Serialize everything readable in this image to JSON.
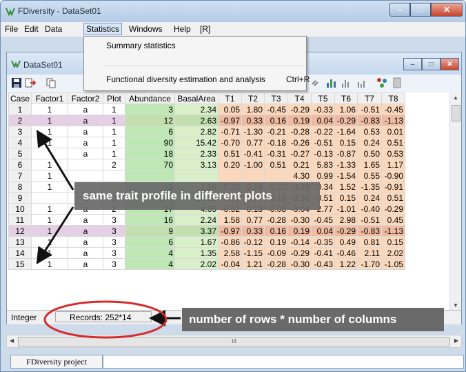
{
  "app": {
    "title": "FDiversity - DataSet01",
    "window_buttons": {
      "minimize": "–",
      "maximize": "□",
      "close": "✕"
    }
  },
  "menubar": [
    "File",
    "Edit",
    "Data",
    "Statistics",
    "Windows",
    "Help",
    "[R]"
  ],
  "statistics_menu": {
    "items": [
      {
        "label": "Summary statistics",
        "shortcut": ""
      },
      {
        "label": "Functional diversity estimation and analysis",
        "shortcut": "Ctrl+R"
      }
    ]
  },
  "dataset_window": {
    "title": "DataSet01"
  },
  "grid": {
    "columns": [
      "Case",
      "Factor1",
      "Factor2",
      "Plot",
      "Abundance",
      "BasalArea",
      "T1",
      "T2",
      "T3",
      "T4",
      "T5",
      "T6",
      "T7",
      "T8"
    ],
    "rows": [
      [
        "1",
        "1",
        "a",
        "1",
        "3",
        "2.34",
        "0.05",
        "1.80",
        "-0.45",
        "-0.29",
        "-0.33",
        "1.06",
        "-0.51",
        "-0.45"
      ],
      [
        "2",
        "1",
        "a",
        "1",
        "12",
        "2.63",
        "-0.97",
        "0.33",
        "0.16",
        "0.19",
        "0.04",
        "-0.29",
        "-0.83",
        "-1.13"
      ],
      [
        "3",
        "1",
        "a",
        "1",
        "6",
        "2.82",
        "-0.71",
        "-1.30",
        "-0.21",
        "-0.28",
        "-0.22",
        "-1.64",
        "0.53",
        "0.01"
      ],
      [
        "4",
        "1",
        "a",
        "1",
        "90",
        "15.42",
        "-0.70",
        "0.77",
        "-0.18",
        "-0.26",
        "-0.51",
        "0.15",
        "0.24",
        "0.51"
      ],
      [
        "5",
        "",
        "a",
        "1",
        "18",
        "2.33",
        "0.51",
        "-0.41",
        "-0.31",
        "-0.27",
        "-0.13",
        "-0.87",
        "0.50",
        "0.53"
      ],
      [
        "6",
        "1",
        "",
        "2",
        "70",
        "3.13",
        "0.20",
        "-1.00",
        "0.51",
        "0.21",
        "5.83",
        "-1.33",
        "1.65",
        "1.17"
      ],
      [
        "7",
        "1",
        "",
        "",
        "",
        "",
        "",
        "",
        "",
        "4.30",
        "0.99",
        "-1.54",
        "0.55",
        "-0.90"
      ],
      [
        "8",
        "1",
        "",
        "",
        "1",
        "1.28",
        "-0.20",
        "0.18",
        "-0.27",
        "-0.29",
        "-0.34",
        "1.52",
        "-1.35",
        "-0.91"
      ],
      [
        "9",
        "",
        "a",
        "2",
        "140",
        "21.02",
        "-0.70",
        "0.77",
        "-0.18",
        "-0.26",
        "-0.51",
        "0.15",
        "0.24",
        "0.51"
      ],
      [
        "10",
        "1",
        "a",
        "2",
        "17",
        "4.65",
        "-0.52",
        "0.18",
        "-0.08",
        "-0.04",
        "2.77",
        "-1.01",
        "-0.40",
        "-0.29"
      ],
      [
        "11",
        "1",
        "a",
        "3",
        "16",
        "2.24",
        "1.58",
        "0.77",
        "-0.28",
        "-0.30",
        "-0.45",
        "2.98",
        "-0.51",
        "0.45"
      ],
      [
        "12",
        "1",
        "a",
        "3",
        "9",
        "3.37",
        "-0.97",
        "0.33",
        "0.16",
        "0.19",
        "0.04",
        "-0.29",
        "-0.83",
        "-1.13"
      ],
      [
        "13",
        "1",
        "a",
        "3",
        "6",
        "1.67",
        "-0.86",
        "-0.12",
        "0.19",
        "-0.14",
        "-0.35",
        "0.49",
        "0.81",
        "0.15"
      ],
      [
        "14",
        "1",
        "a",
        "3",
        "4",
        "1.35",
        "2.58",
        "-1.15",
        "-0.09",
        "-0.29",
        "-0.41",
        "-0.46",
        "2.11",
        "2.02"
      ],
      [
        "15",
        "1",
        "a",
        "3",
        "4",
        "2.02",
        "-0.04",
        "1.21",
        "-0.28",
        "-0.30",
        "-0.43",
        "1.22",
        "-1.70",
        "-1.05"
      ]
    ]
  },
  "status": {
    "type": "Integer",
    "records": "Records: 252*14"
  },
  "hscroll": {
    "thumb": "III"
  },
  "bottom": {
    "project": "FDiversity project"
  },
  "annotations": {
    "trait_profile": "same trait profile in different plots",
    "records_info": "number of rows * number of columns"
  },
  "colors": {
    "abundance": "#bfe7b5",
    "basal_area": "#d9efc9",
    "traits": "#fbd8bc",
    "highlight_row": "#e4d0e4",
    "callout": "#6a6a6a"
  }
}
